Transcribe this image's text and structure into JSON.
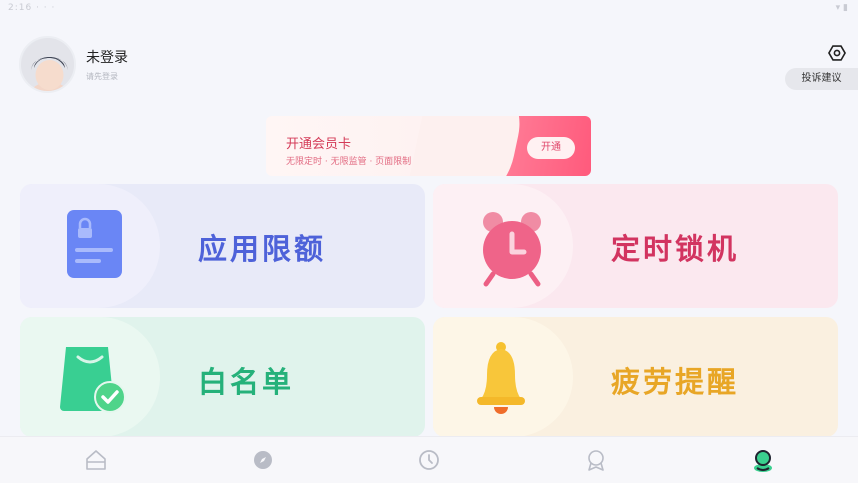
{
  "status_bar": {
    "left": "2:16 ·  ·  · ",
    "right": "▾ ▮"
  },
  "profile": {
    "username": "未登录",
    "login_hint": "请先登录"
  },
  "feedback": {
    "label": "投诉建议"
  },
  "vip": {
    "title": "开通会员卡",
    "subtitle": "无限定时 · 无限监管 · 页面限制",
    "button_label": "开通"
  },
  "features": {
    "quota": {
      "label": "应用限额",
      "color": "#4e62d9"
    },
    "timer": {
      "label": "定时锁机",
      "color": "#d23460"
    },
    "whitelist": {
      "label": "白名单",
      "color": "#25b17a"
    },
    "fatigue": {
      "label": "疲劳提醒",
      "color": "#e8a626"
    }
  },
  "bottom_nav": [
    {
      "icon": "home-icon",
      "active": false
    },
    {
      "icon": "compass-icon",
      "active": false
    },
    {
      "icon": "clock-icon",
      "active": false
    },
    {
      "icon": "badge-icon",
      "active": false
    },
    {
      "icon": "profile-icon",
      "active": true
    }
  ]
}
